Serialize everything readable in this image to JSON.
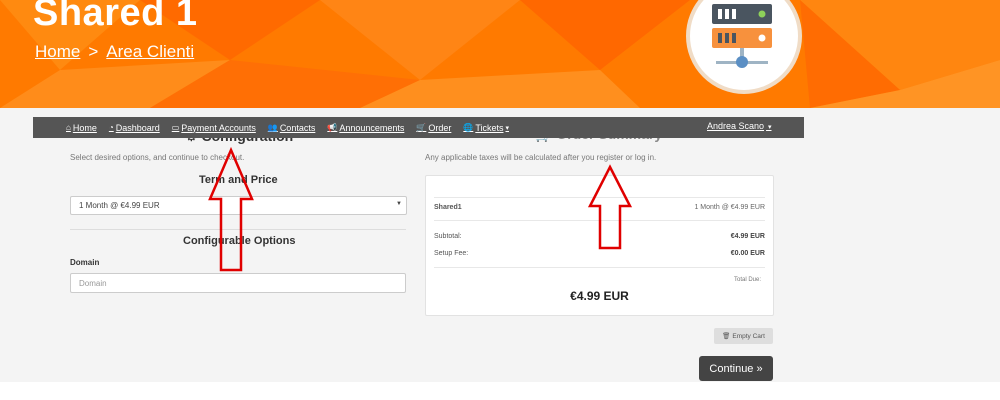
{
  "header": {
    "title": "Shared 1",
    "breadcrumb": {
      "home": "Home",
      "separator": ">",
      "current": "Area Clienti"
    },
    "brand_color": "#ff7a00",
    "logo_icon": "server-icon"
  },
  "navbar": {
    "items": [
      {
        "label": "Home",
        "icon": "home-icon"
      },
      {
        "label": "Dashboard",
        "icon": "dashboard-icon"
      },
      {
        "label": "Payment Accounts",
        "icon": "credit-card-icon"
      },
      {
        "label": "Contacts",
        "icon": "users-icon"
      },
      {
        "label": "Announcements",
        "icon": "bullhorn-icon"
      },
      {
        "label": "Order",
        "icon": "cart-icon"
      },
      {
        "label": "Tickets",
        "icon": "globe-icon"
      }
    ],
    "user": "Andrea Scano"
  },
  "configure": {
    "heading": "Configuration",
    "intro": "Select desired options, and continue to checkout.",
    "term_heading": "Term and Price",
    "term_selected": "1 Month @ €4.99 EUR",
    "options_heading": "Configurable Options",
    "domain_label": "Domain",
    "domain_placeholder": "Domain"
  },
  "summary": {
    "heading": "Order Summary",
    "tax_note": "Any applicable taxes will be calculated after you register or log in.",
    "product_name": "Shared1",
    "product_price": "1 Month @ €4.99 EUR",
    "subtotal_label": "Subtotal:",
    "subtotal_value": "€4.99 EUR",
    "setup_label": "Setup Fee:",
    "setup_value": "€0.00 EUR",
    "total_label": "Total Due:",
    "total_value": "€4.99 EUR"
  },
  "buttons": {
    "empty_cart": "Empty Cart",
    "continue": "Continue »"
  },
  "annotation_color": "#e00000"
}
